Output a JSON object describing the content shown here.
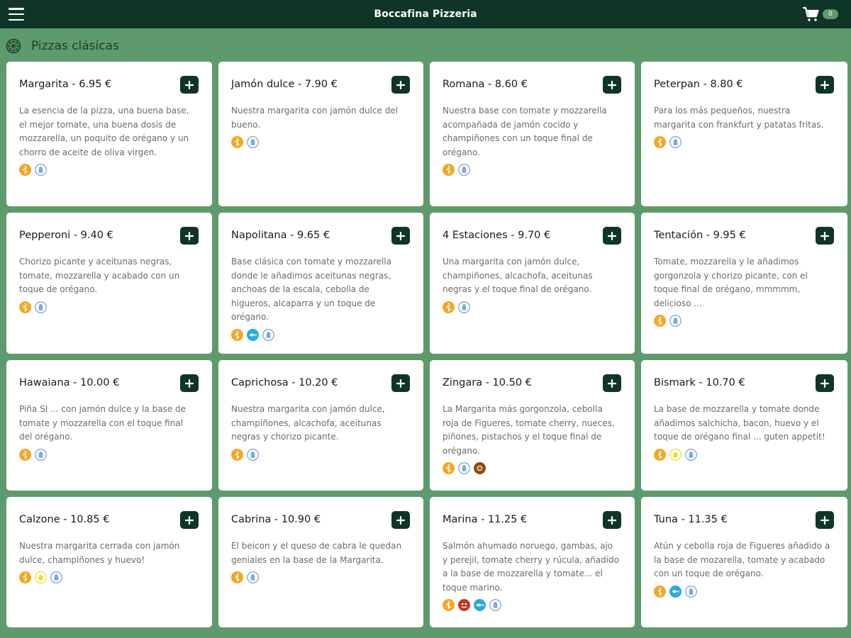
{
  "app": {
    "title": "Boccafina Pizzeria",
    "cart_count": "0"
  },
  "section": {
    "title": "Pizzas clásicas"
  },
  "colors": {
    "topbar": "#0f3526",
    "background": "#5f9a6c",
    "gluten": "#f5a623",
    "lactose": "#7fa8d8",
    "fish": "#29a9e0",
    "egg": "#f0dd3c",
    "nuts": "#8a4b16",
    "crustacean": "#c0392b"
  },
  "items": [
    {
      "title": "Margarita - 6.95 €",
      "desc": "La esencia de la pizza, una buena base, el mejor tomate, una buena dosis de mozzarella, un poquito de orégano y un chorro de aceite de oliva virgen.",
      "allergens": [
        "gluten-icon",
        "lactose-icon"
      ]
    },
    {
      "title": "Jamón dulce - 7.90 €",
      "desc": "Nuestra margarita con jamón dulce del bueno.",
      "allergens": [
        "gluten-icon",
        "lactose-icon"
      ]
    },
    {
      "title": "Romana - 8.60 €",
      "desc": "Nuestra base con tomate y mozzarella acompañada de jamón cocido y champiñones con un toque final de orégano.",
      "allergens": [
        "gluten-icon",
        "lactose-icon"
      ]
    },
    {
      "title": "Peterpan - 8.80 €",
      "desc": "Para los más pequeños, nuestra margarita con frankfurt y patatas fritas.",
      "allergens": [
        "gluten-icon",
        "lactose-icon"
      ]
    },
    {
      "title": "Pepperoni - 9.40 €",
      "desc": "Chorizo picante y aceitunas negras, tomate, mozzarella y acabado con un toque de orégano.",
      "allergens": [
        "gluten-icon",
        "lactose-icon"
      ]
    },
    {
      "title": "Napolitana - 9.65 €",
      "desc": "Base clásica con tomate y mozzarella donde le añadimos aceitunas negras, anchoas de la escala, cebolla de higueros, alcaparra y un toque de orégano.",
      "allergens": [
        "gluten-icon",
        "fish-icon",
        "lactose-icon"
      ]
    },
    {
      "title": "4 Estaciones - 9.70 €",
      "desc": "Una margarita con jamón dulce, champiñones, alcachofa, aceitunas negras y el toque final de orégano.",
      "allergens": [
        "gluten-icon",
        "lactose-icon"
      ]
    },
    {
      "title": "Tentación - 9.95 €",
      "desc": "Tomate, mozzarella y le añadimos gorgonzola y chorizo picante, con el toque final de orégano, mmmmm, delicioso ...",
      "allergens": [
        "gluten-icon",
        "lactose-icon"
      ]
    },
    {
      "title": "Hawaiana - 10.00 €",
      "desc": "Piña SI ... con jamón dulce y la base de tomate y mozzarella con el toque final del orégano.",
      "allergens": [
        "gluten-icon",
        "lactose-icon"
      ]
    },
    {
      "title": "Caprichosa - 10.20 €",
      "desc": "Nuestra margarita con jamón dulce, champiñones, alcachofa, aceitunas negras y chorizo picante.",
      "allergens": [
        "gluten-icon",
        "lactose-icon"
      ]
    },
    {
      "title": "Zingara - 10.50 €",
      "desc": "La Margarita más gorgonzola, cebolla roja de Figueres, tomate cherry, nueces, piñones, pistachos y el toque final de orégano.",
      "allergens": [
        "gluten-icon",
        "lactose-icon",
        "nuts-icon"
      ]
    },
    {
      "title": "Bismark - 10.70 €",
      "desc": "La base de mozzarella y tomate donde añadimos salchicha, bacon, huevo y el toque de orégano final ... guten appetit!",
      "allergens": [
        "gluten-icon",
        "egg-icon",
        "lactose-icon"
      ]
    },
    {
      "title": "Calzone - 10.85 €",
      "desc": "Nuestra margarita cerrada con jamón dulce, champiñones y huevo!",
      "allergens": [
        "gluten-icon",
        "egg-icon",
        "lactose-icon"
      ]
    },
    {
      "title": "Cabrina - 10.90 €",
      "desc": "El beicon y el queso de cabra le quedan geniales en la base de la Margarita.",
      "allergens": [
        "gluten-icon",
        "lactose-icon"
      ]
    },
    {
      "title": "Marina - 11.25 €",
      "desc": "Salmón ahumado noruego, gambas, ajo y perejil, tomate cherry y rúcula, añadido a la base de mozzarella y tomate... el toque marino.",
      "allergens": [
        "gluten-icon",
        "crustacean-icon",
        "fish-icon",
        "lactose-icon"
      ]
    },
    {
      "title": "Tuna - 11.35 €",
      "desc": "Atún y cebolla roja de Figueres añadido a la base de mozarella, tomate y acabado con un toque de orégano.",
      "allergens": [
        "gluten-icon",
        "fish-icon",
        "lactose-icon"
      ]
    }
  ]
}
